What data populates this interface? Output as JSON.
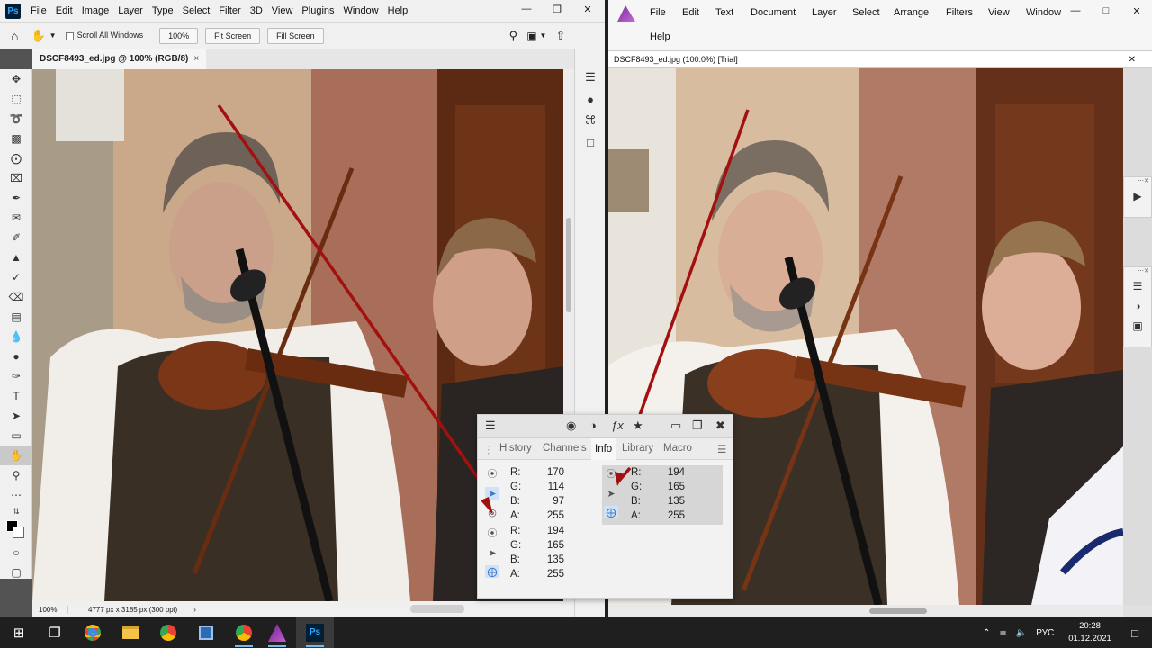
{
  "photoshop": {
    "logo": "Ps",
    "menu": [
      "File",
      "Edit",
      "Image",
      "Layer",
      "Type",
      "Select",
      "Filter",
      "3D",
      "View",
      "Plugins",
      "Window",
      "Help"
    ],
    "options": {
      "scroll_all_windows": "Scroll All Windows",
      "zoom_100": "100%",
      "fit_screen": "Fit Screen",
      "fill_screen": "Fill Screen"
    },
    "doc_tab": "DSCF8493_ed.jpg @ 100% (RGB/8)",
    "status": {
      "zoom": "100%",
      "info": "4777 px x 3185 px (300 ppi)"
    }
  },
  "affinity": {
    "menu_row1": [
      "File",
      "Edit",
      "Text",
      "Document",
      "Layer",
      "Select",
      "Arrange",
      "Filters",
      "View",
      "Window"
    ],
    "menu_row2": [
      "Help"
    ],
    "doc_tab": "DSCF8493_ed.jpg (100.0%) [Trial]"
  },
  "info_panel": {
    "tabs": [
      "History",
      "Channels",
      "Info",
      "Library",
      "Macro"
    ],
    "active_tab": "Info",
    "readout1": [
      {
        "label": "R:",
        "value": "170"
      },
      {
        "label": "G:",
        "value": "114"
      },
      {
        "label": "B:",
        "value": "97"
      },
      {
        "label": "A:",
        "value": "255"
      }
    ],
    "readout2": [
      {
        "label": "R:",
        "value": "194"
      },
      {
        "label": "G:",
        "value": "165"
      },
      {
        "label": "B:",
        "value": "135"
      },
      {
        "label": "A:",
        "value": "255"
      }
    ],
    "readout3": [
      {
        "label": "R:",
        "value": "194"
      },
      {
        "label": "G:",
        "value": "165"
      },
      {
        "label": "B:",
        "value": "135"
      },
      {
        "label": "A:",
        "value": "255"
      }
    ]
  },
  "taskbar": {
    "language": "РУС",
    "time": "20:28",
    "date": "01.12.2021"
  },
  "colors": {
    "annotation_arrow": "#a31010",
    "ps_accent": "#31a8ff",
    "affinity_accent": "#9c3fc0"
  }
}
